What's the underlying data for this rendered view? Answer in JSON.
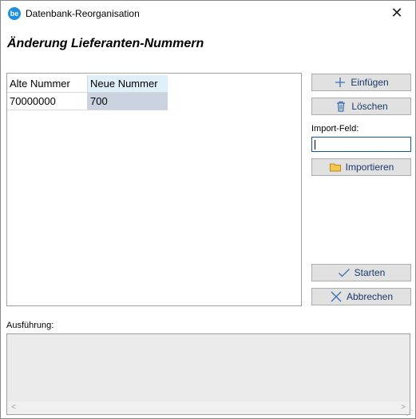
{
  "window": {
    "title": "Datenbank-Reorganisation",
    "icon_text": "be",
    "close_glyph": "✕"
  },
  "heading": "Änderung Lieferanten-Nummern",
  "grid": {
    "columns": [
      "Alte Nummer",
      "Neue Nummer"
    ],
    "rows": [
      [
        "70000000",
        "700"
      ]
    ]
  },
  "buttons": {
    "insert": "Einfügen",
    "delete": "Löschen",
    "import": "Importieren",
    "start": "Starten",
    "cancel": "Abbrechen"
  },
  "import_field": {
    "label": "Import-Feld:",
    "value": ""
  },
  "log": {
    "label": "Ausführung:"
  },
  "scroll": {
    "left_arrow": "<",
    "right_arrow": ">"
  },
  "colors": {
    "accent": "#1e8fe0",
    "selected_cell": "#cbd3e0",
    "header_highlight": "#e0f0fb",
    "button_text": "#1a3a6a"
  },
  "icons": {
    "insert": "plus-icon",
    "delete": "trash-icon",
    "import": "folder-icon",
    "start": "checkmark-icon",
    "cancel": "x-icon"
  }
}
